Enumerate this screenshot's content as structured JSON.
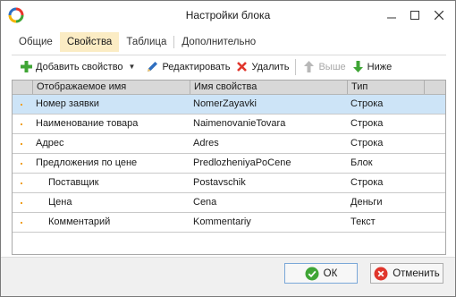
{
  "window": {
    "title": "Настройки блока"
  },
  "tabs": [
    {
      "label": "Общие",
      "active": false
    },
    {
      "label": "Свойства",
      "active": true
    },
    {
      "label": "Таблица",
      "active": false
    },
    {
      "label": "Дополнительно",
      "active": false
    }
  ],
  "toolbar": {
    "add_label": "Добавить свойство",
    "edit_label": "Редактировать",
    "delete_label": "Удалить",
    "up_label": "Выше",
    "down_label": "Ниже"
  },
  "grid": {
    "columns": [
      "Отображаемое имя",
      "Имя свойства",
      "Тип"
    ],
    "rows": [
      {
        "name": "Номер заявки",
        "property": "NomerZayavki",
        "type": "Строка",
        "indent": 0,
        "selected": true
      },
      {
        "name": "Наименование товара",
        "property": "NaimenovanieTovara",
        "type": "Строка",
        "indent": 0,
        "selected": false
      },
      {
        "name": "Адрес",
        "property": "Adres",
        "type": "Строка",
        "indent": 0,
        "selected": false
      },
      {
        "name": "Предложения по цене",
        "property": "PredlozheniyaPoCene",
        "type": "Блок",
        "indent": 0,
        "selected": false
      },
      {
        "name": "Поставщик",
        "property": "Postavschik",
        "type": "Строка",
        "indent": 1,
        "selected": false
      },
      {
        "name": "Цена",
        "property": "Cena",
        "type": "Деньги",
        "indent": 1,
        "selected": false
      },
      {
        "name": "Комментарий",
        "property": "Kommentariy",
        "type": "Текст",
        "indent": 1,
        "selected": false
      }
    ]
  },
  "footer": {
    "ok_label": "ОК",
    "cancel_label": "Отменить"
  },
  "colors": {
    "active_tab": "#fbecc4",
    "selected_row": "#cde4f7",
    "add_icon": "#3fa535",
    "delete_icon": "#e0362c",
    "edit_icon": "#2f6fc0",
    "down_icon": "#3fa535",
    "ok_icon": "#3fa535",
    "cancel_icon": "#e0362c"
  }
}
